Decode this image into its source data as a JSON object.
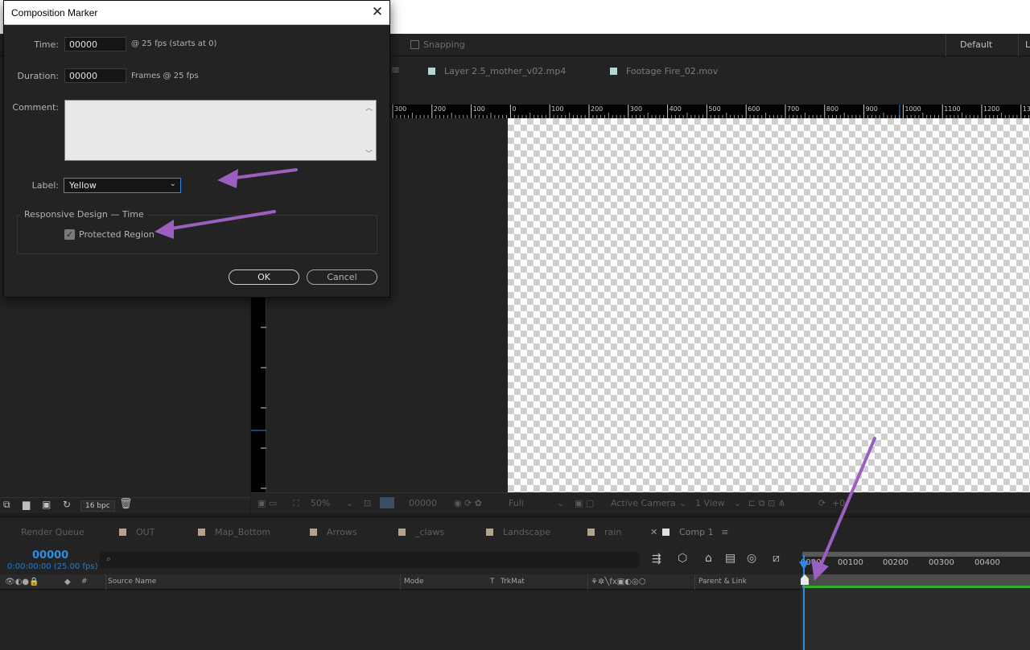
{
  "toolbar": {
    "snapping": "Snapping",
    "workspace": "Default",
    "workspace_next": "L"
  },
  "viewer": {
    "tabs": [
      {
        "label": "Layer 2.5_mother_v02.mp4",
        "color": "#b4d7d2"
      },
      {
        "label": "Footage Fire_02.mov",
        "color": "#b4d7d2"
      }
    ],
    "ruler_ticks": [
      "300",
      "200",
      "100",
      "0",
      "100",
      "200",
      "300",
      "400",
      "500",
      "600",
      "700",
      "800",
      "900",
      "1000",
      "1100",
      "1200",
      "130"
    ],
    "bottom": {
      "zoom": "50%",
      "timecode": "00000",
      "resolution": "Full",
      "camera": "Active Camera",
      "views": "1 View",
      "exposure": "+0"
    }
  },
  "project": {
    "bpc": "16 bpc"
  },
  "timeline": {
    "tabs": [
      "Render Queue",
      "OUT",
      "Map_Bottom",
      "Arrows",
      "_claws",
      "Landscape",
      "rain",
      "Comp 1"
    ],
    "tab_swatch": "#b6a28a",
    "timecode": "00000",
    "timecode_sub": "0:00:00:00 (25.00 fps)",
    "columns": {
      "hash": "#",
      "source": "Source Name",
      "mode": "Mode",
      "t": "T",
      "trkmat": "TrkMat",
      "parent": "Parent & Link"
    },
    "ruler": [
      "0000",
      "00100",
      "00200",
      "00300",
      "00400"
    ]
  },
  "dialog": {
    "title": "Composition Marker",
    "time_label": "Time:",
    "time_value": "00000",
    "time_note": "@ 25 fps (starts at 0)",
    "duration_label": "Duration:",
    "duration_value": "00000",
    "duration_note": "Frames @ 25 fps",
    "comment_label": "Comment:",
    "label_label": "Label:",
    "label_value": "Yellow",
    "section_title": "Responsive Design — Time",
    "protected_region": "Protected Region",
    "protected_checked": true,
    "ok": "OK",
    "cancel": "Cancel"
  },
  "annotation_color": "#9b5fc0"
}
